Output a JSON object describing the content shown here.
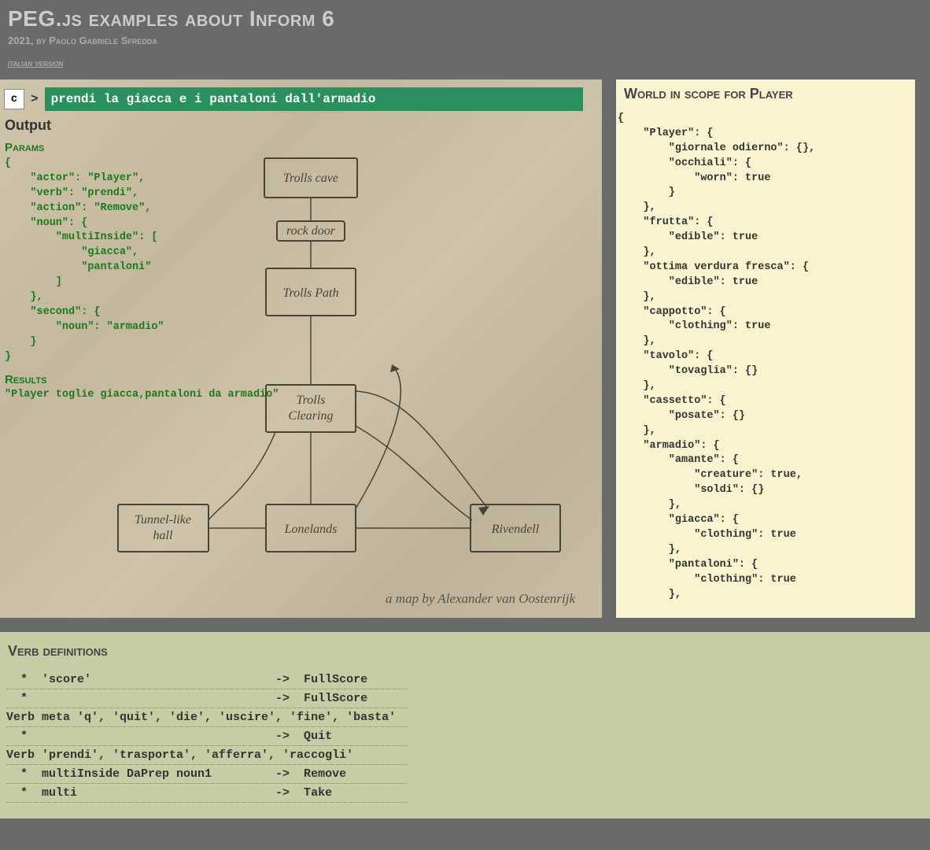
{
  "header": {
    "title": "PEG.js examples about Inform 6",
    "subtitle": "2021, by Paolo Gabriele Sfredda",
    "link": "italian version"
  },
  "command": {
    "button": "c",
    "prompt": ">",
    "value": "prendi la giacca e i pantaloni dall'armadio"
  },
  "output": {
    "heading": "Output",
    "params_heading": "Params",
    "params_json": "{\n    \"actor\": \"Player\",\n    \"verb\": \"prendi\",\n    \"action\": \"Remove\",\n    \"noun\": {\n        \"multiInside\": [\n            \"giacca\",\n            \"pantaloni\"\n        ]\n    },\n    \"second\": {\n        \"noun\": \"armadio\"\n    }\n}",
    "results_heading": "Results",
    "results_text": "\"Player toglie giacca,pantaloni da armadio\""
  },
  "world": {
    "heading": "World in scope for Player",
    "json": "{\n    \"Player\": {\n        \"giornale odierno\": {},\n        \"occhiali\": {\n            \"worn\": true\n        }\n    },\n    \"frutta\": {\n        \"edible\": true\n    },\n    \"ottima verdura fresca\": {\n        \"edible\": true\n    },\n    \"cappotto\": {\n        \"clothing\": true\n    },\n    \"tavolo\": {\n        \"tovaglia\": {}\n    },\n    \"cassetto\": {\n        \"posate\": {}\n    },\n    \"armadio\": {\n        \"amante\": {\n            \"creature\": true,\n            \"soldi\": {}\n        },\n        \"giacca\": {\n            \"clothing\": true\n        },\n        \"pantaloni\": {\n            \"clothing\": true\n        },"
  },
  "map": {
    "credit": "a map by Alexander van Oostenrijk",
    "nodes": {
      "trolls_cave": "Trolls cave",
      "rock_door": "rock door",
      "trolls_path": "Trolls Path",
      "trolls_clearing": "Trolls Clearing",
      "tunnel_hall": "Tunnel-like hall",
      "lonelands": "Lonelands",
      "rivendell": "Rivendell"
    }
  },
  "verbs": {
    "heading": "Verb definitions",
    "rows": [
      "  *  'score'                          ->  FullScore",
      "  *                                   ->  FullScore",
      "Verb meta 'q', 'quit', 'die', 'uscire', 'fine', 'basta'",
      "  *                                   ->  Quit",
      "Verb 'prendi', 'trasporta', 'afferra', 'raccogli'",
      "  *  multiInside DaPrep noun1         ->  Remove",
      "  *  multi                            ->  Take"
    ]
  }
}
